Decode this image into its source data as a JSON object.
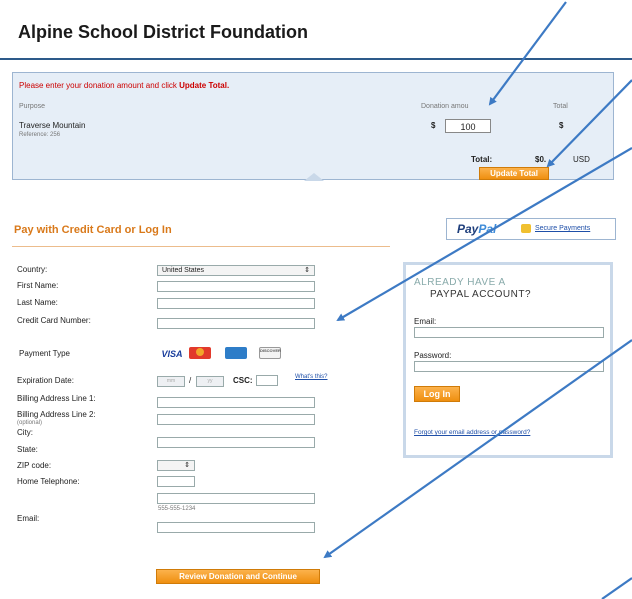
{
  "header": {
    "title": "Alpine School District Foundation"
  },
  "donation": {
    "instruction_prefix": "Please enter your donation amount and click ",
    "instruction_bold": "Update Total.",
    "purpose_label": "Purpose",
    "donation_amount_label": "Donation amou",
    "total_label": "Total",
    "purpose_name": "Traverse Mountain",
    "reference": "Reference: 256",
    "currency_symbol": "$",
    "amount_value": "100",
    "total_currency_symbol": "$",
    "total_row_label": "Total:",
    "total_value": "$0.",
    "total_currency": "USD",
    "update_button": "Update Total"
  },
  "payment": {
    "section_title": "Pay with Credit Card or Log In",
    "paypal_logo_1": "Pay",
    "paypal_logo_2": "Pal",
    "secure_payments": "Secure Payments",
    "fields": {
      "country_label": "Country:",
      "country_value": "United States",
      "first_name_label": "First Name:",
      "last_name_label": "Last Name:",
      "cc_label": "Credit Card Number:",
      "payment_type_label": "Payment Type",
      "expiration_label": "Expiration Date:",
      "exp_month_placeholder": "mm",
      "exp_year_placeholder": "yy",
      "exp_separator": "/",
      "csc_label": "CSC:",
      "whats_this": "What's this?",
      "billing1_label": "Billing Address Line 1:",
      "billing2_label": "Billing Address Line 2:",
      "billing2_optional": "(optional)",
      "city_label": "City:",
      "state_label": "State:",
      "zip_label": "ZIP code:",
      "phone_label": "Home Telephone:",
      "phone_hint": "555-555-1234",
      "email_label": "Email:"
    },
    "cards": [
      "VISA",
      "MC",
      "AMEX",
      "DISCOVER"
    ],
    "review_button": "Review Donation and Continue"
  },
  "login": {
    "heading_line1": "ALREADY HAVE A",
    "heading_line2": "PAYPAL ACCOUNT?",
    "email_label": "Email:",
    "password_label": "Password:",
    "login_button": "Log In",
    "forgot_link": "Forgot your email address or password?"
  },
  "colors": {
    "accent_orange": "#ef8f10",
    "section_title": "#d9791a",
    "header_rule": "#2d5a8a",
    "arrow": "#3d7ac4"
  }
}
